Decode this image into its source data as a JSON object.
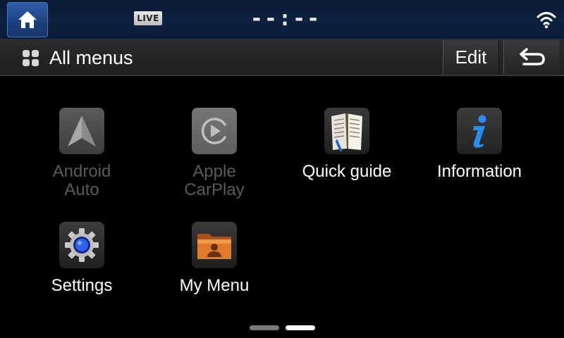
{
  "status_bar": {
    "live_badge": "LIVE",
    "clock": "--:--",
    "icons": [
      "home-icon",
      "wifi-icon"
    ]
  },
  "title_bar": {
    "title": "All menus",
    "edit_label": "Edit",
    "icons": [
      "all-menus-icon",
      "back-arrow-icon"
    ]
  },
  "menu": {
    "items": [
      {
        "label": "Android\nAuto",
        "icon": "android-auto-icon",
        "enabled": false
      },
      {
        "label": "Apple\nCarPlay",
        "icon": "apple-carplay-icon",
        "enabled": false
      },
      {
        "label": "Quick guide",
        "icon": "book-icon",
        "enabled": true
      },
      {
        "label": "Information",
        "icon": "info-icon",
        "enabled": true
      },
      {
        "label": "Settings",
        "icon": "gear-icon",
        "enabled": true
      },
      {
        "label": "My Menu",
        "icon": "folder-user-icon",
        "enabled": true
      }
    ]
  },
  "pagination": {
    "page_count": 2,
    "current_page": 2
  },
  "colors": {
    "status_bar_bg": "#0d2241",
    "home_button": "#2f5ea8",
    "title_bar_bg": "#262626",
    "disabled_text": "#5a5a5a",
    "active_dot": "#ffffff",
    "inactive_dot": "#7a7a7a"
  }
}
